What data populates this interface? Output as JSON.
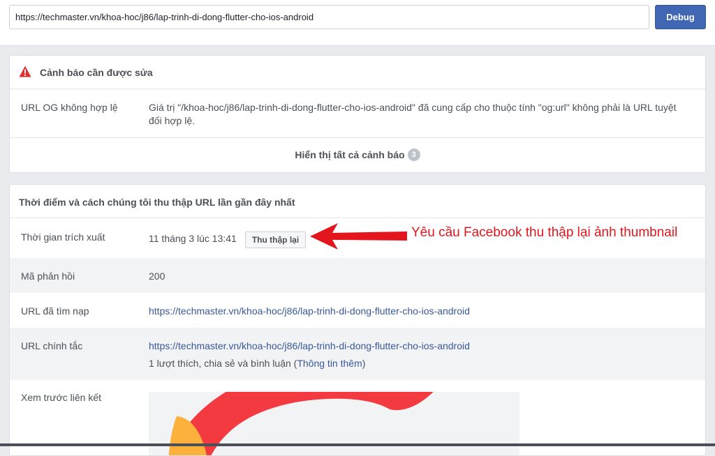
{
  "toolbar": {
    "url_value": "https://techmaster.vn/khoa-hoc/j86/lap-trinh-di-dong-flutter-cho-ios-android",
    "debug_label": "Debug"
  },
  "warnings": {
    "title": "Cảnh báo cần được sửa",
    "items": [
      {
        "label": "URL OG không hợp lệ",
        "message": "Giá trị \"/khoa-hoc/j86/lap-trinh-di-dong-flutter-cho-ios-android\" đã cung cấp cho thuộc tính \"og:url\" không phải là URL tuyệt đối hợp lệ."
      }
    ],
    "show_all_label": "Hiển thị tất cả cảnh báo",
    "count": "3"
  },
  "scrape": {
    "title": "Thời điểm và cách chúng tôi thu thập URL lần gần đây nhất",
    "time_label": "Thời gian trích xuất",
    "time_value": "11 tháng 3 lúc 13:41",
    "rescrape_label": "Thu thập lại",
    "response_label": "Mã phản hồi",
    "response_value": "200",
    "fetched_label": "URL đã tìm nạp",
    "fetched_value": "https://techmaster.vn/khoa-hoc/j86/lap-trinh-di-dong-flutter-cho-ios-android",
    "canonical_label": "URL chính tắc",
    "canonical_value": "https://techmaster.vn/khoa-hoc/j86/lap-trinh-di-dong-flutter-cho-ios-android",
    "engagement_text": "1 lượt thích, chia sẻ và bình luận (",
    "more_info_label": "Thông tin thêm",
    "engagement_close": ")",
    "preview_label": "Xem trước liên kết"
  },
  "annotation": {
    "text": "Yêu cầu Facebook thu thập lại ảnh thumbnail",
    "color": "#e3161d"
  },
  "colors": {
    "accent": "#4267b2",
    "link": "#385898",
    "warning_icon": "#e02f2f"
  }
}
